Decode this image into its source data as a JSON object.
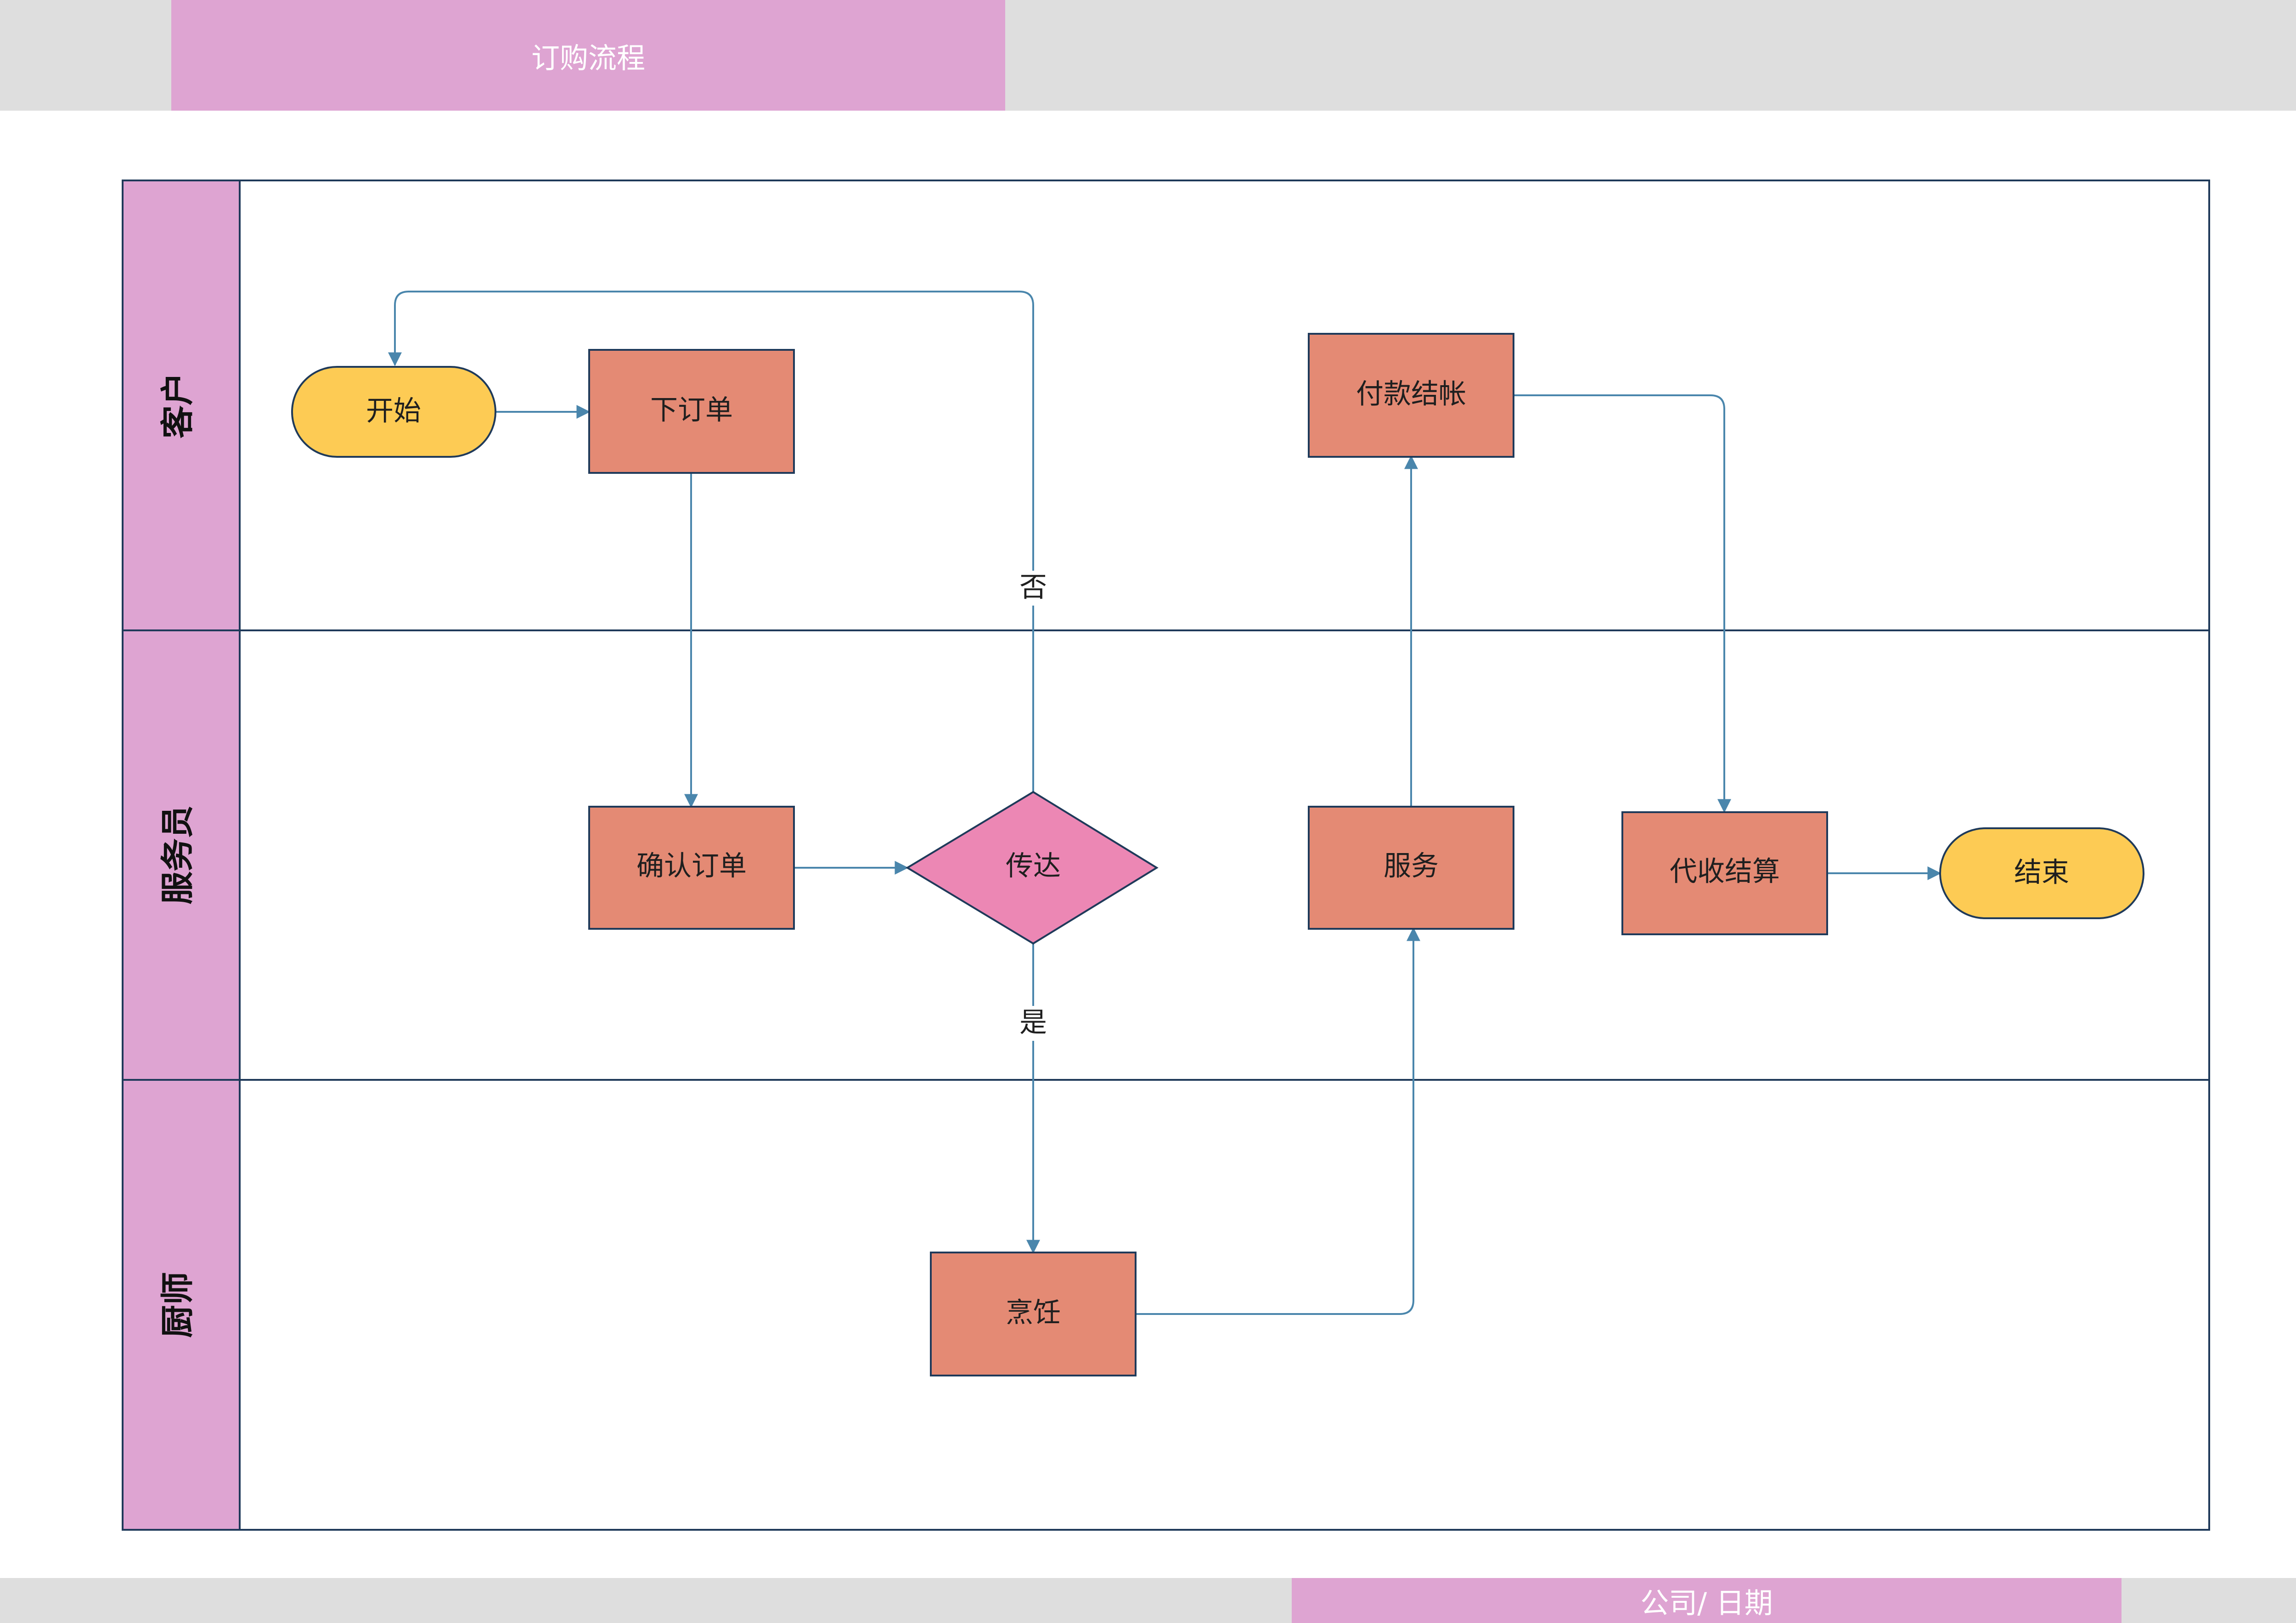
{
  "header": {
    "title": "订购流程"
  },
  "footer": {
    "text": "公司/ 日期"
  },
  "lanes": [
    {
      "id": "customer",
      "label": "客户"
    },
    {
      "id": "waiter",
      "label": "服务员"
    },
    {
      "id": "chef",
      "label": "厨师"
    }
  ],
  "nodes": {
    "start": {
      "label": "开始",
      "shape": "terminator",
      "color": "#fdcb54"
    },
    "place_order": {
      "label": "下订单",
      "shape": "process",
      "color": "#e48a74"
    },
    "confirm_order": {
      "label": "确认订单",
      "shape": "process",
      "color": "#e48a74"
    },
    "relay": {
      "label": "传达",
      "shape": "decision",
      "color": "#ec87b4"
    },
    "cook": {
      "label": "烹饪",
      "shape": "process",
      "color": "#e48a74"
    },
    "serve": {
      "label": "服务",
      "shape": "process",
      "color": "#e48a74"
    },
    "pay": {
      "label": "付款结帐",
      "shape": "process",
      "color": "#e48a74"
    },
    "collect": {
      "label": "代收结算",
      "shape": "process",
      "color": "#e48a74"
    },
    "end": {
      "label": "结束",
      "shape": "terminator",
      "color": "#fdcb54"
    }
  },
  "edges": [
    {
      "from": "start",
      "to": "place_order",
      "label": ""
    },
    {
      "from": "place_order",
      "to": "confirm_order",
      "label": ""
    },
    {
      "from": "confirm_order",
      "to": "relay",
      "label": ""
    },
    {
      "from": "relay",
      "to": "start",
      "label": "否"
    },
    {
      "from": "relay",
      "to": "cook",
      "label": "是"
    },
    {
      "from": "cook",
      "to": "serve",
      "label": ""
    },
    {
      "from": "serve",
      "to": "pay",
      "label": ""
    },
    {
      "from": "pay",
      "to": "collect",
      "label": ""
    },
    {
      "from": "collect",
      "to": "end",
      "label": ""
    }
  ],
  "colors": {
    "accent": "#dea4d2",
    "band": "#dedede",
    "border": "#1f3a5a",
    "connector": "#4a86ac"
  }
}
